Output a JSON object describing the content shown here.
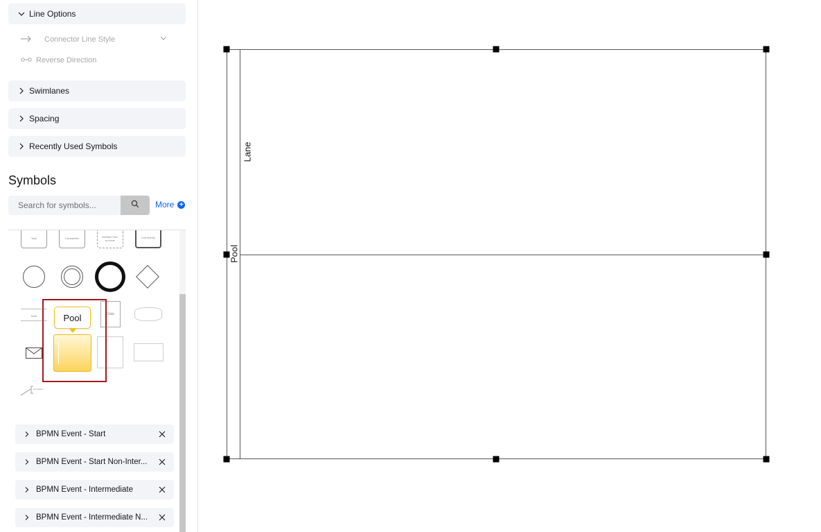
{
  "sections": {
    "line_options": "Line Options",
    "connector_line_style": "Connector Line Style",
    "reverse_direction": "Reverse Direction",
    "swimlanes": "Swimlanes",
    "spacing": "Spacing",
    "recently_used": "Recently Used Symbols"
  },
  "symbols": {
    "title": "Symbols",
    "search_placeholder": "Search for symbols...",
    "more_label": "More",
    "tooltip": "Pool",
    "tiny_labels": {
      "task": "Task",
      "transaction": "Transaction",
      "subprocess": "Multiple Sub-process",
      "call_activity": "Call Activity",
      "note": "Note",
      "data": "Data",
      "annotation": "Annotation"
    }
  },
  "recent_items": [
    "BPMN Event - Start",
    "BPMN Event - Start Non-Inter...",
    "BPMN Event - Intermediate",
    "BPMN Event - Intermediate N..."
  ],
  "canvas": {
    "pool_label": "Pool",
    "lane_label": "Lane"
  },
  "colors": {
    "highlight_border": "#a2191f",
    "tooltip_border": "#f1c21b",
    "link": "#0f62fe"
  }
}
